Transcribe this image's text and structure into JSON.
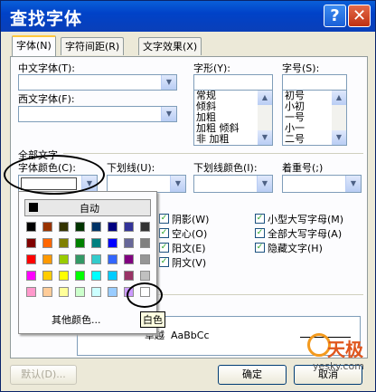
{
  "window": {
    "title": "查找字体",
    "help_glyph": "?",
    "close_glyph": "✕"
  },
  "tabs": [
    {
      "label": "字体(N)",
      "active": true
    },
    {
      "label": "字符间距(R)",
      "active": false
    },
    {
      "label": "文字效果(X)",
      "active": false
    }
  ],
  "fields": {
    "chinese_font_label": "中文字体(T):",
    "chinese_font_value": "",
    "western_font_label": "西文字体(F):",
    "western_font_value": "",
    "style_label": "字形(Y):",
    "style_value": "",
    "style_options": [
      "常规",
      "倾斜",
      "加粗",
      "加粗 倾斜",
      "非 加粗"
    ],
    "size_label": "字号(S):",
    "size_value": "",
    "size_options": [
      "初号",
      "小初",
      "一号",
      "小一",
      "二号"
    ]
  },
  "all_text": {
    "heading": "全部文字",
    "color_label": "字体颜色(C):",
    "underline_label": "下划线(U):",
    "underline_color_label": "下划线颜色(I):",
    "emphasis_label": "着重号(;)"
  },
  "effects": {
    "left": [
      {
        "label": "阴影(W)",
        "checked": true
      },
      {
        "label": "空心(O)",
        "checked": true
      },
      {
        "label": "阳文(E)",
        "checked": true
      },
      {
        "label": "阴文(V)",
        "checked": true
      }
    ],
    "right": [
      {
        "label": "小型大写字母(M)",
        "checked": true
      },
      {
        "label": "全部大写字母(A)",
        "checked": true
      },
      {
        "label": "隐藏文字(H)",
        "checked": true
      }
    ]
  },
  "preview": {
    "text": "卓越  AaBbCc"
  },
  "color_popup": {
    "auto_label": "自动",
    "more_label": "其他颜色...",
    "tooltip": "白色",
    "palette": [
      [
        "#000000",
        "#993300",
        "#333300",
        "#003300",
        "#003366",
        "#000080",
        "#333399",
        "#333333"
      ],
      [
        "#800000",
        "#ff6600",
        "#808000",
        "#008000",
        "#008080",
        "#0000ff",
        "#666699",
        "#808080"
      ],
      [
        "#ff0000",
        "#ff9900",
        "#99cc00",
        "#339966",
        "#33cccc",
        "#3366ff",
        "#800080",
        "#969696"
      ],
      [
        "#ff00ff",
        "#ffcc00",
        "#ffff00",
        "#00ff00",
        "#00ffff",
        "#00ccff",
        "#993366",
        "#c0c0c0"
      ],
      [
        "#ff99cc",
        "#ffcc99",
        "#ffff99",
        "#ccffcc",
        "#ccffff",
        "#99ccff",
        "#cc99ff",
        "#ffffff"
      ]
    ]
  },
  "buttons": {
    "default_label": "默认(D)...",
    "ok_label": "确定",
    "cancel_label": "取消"
  },
  "watermark": {
    "brand": "天极",
    "url": "yesky.com"
  }
}
